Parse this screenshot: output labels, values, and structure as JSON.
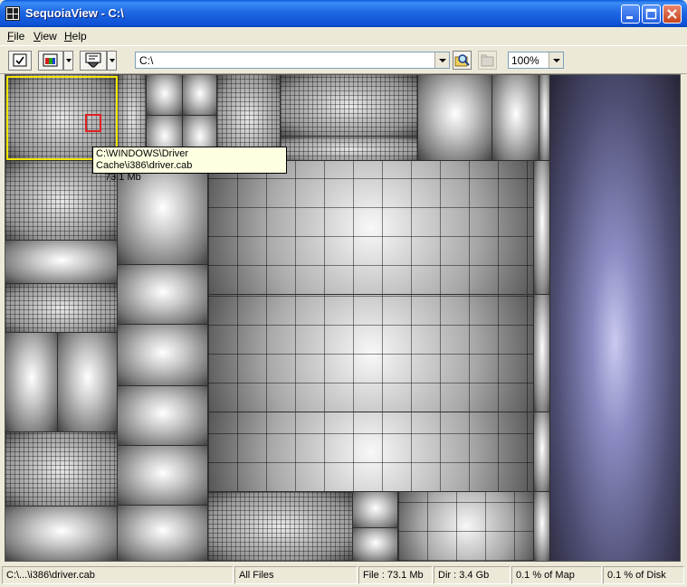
{
  "window": {
    "title": "SequoiaView - C:\\"
  },
  "menu": [
    {
      "key": "F",
      "rest": "ile"
    },
    {
      "key": "V",
      "rest": "iew"
    },
    {
      "key": "H",
      "rest": "elp"
    }
  ],
  "toolbar": {
    "path_value": "C:\\",
    "zoom_value": "100%"
  },
  "tooltip": {
    "path": "C:\\WINDOWS\\Driver Cache\\i386\\driver.cab",
    "size": "73.1 Mb"
  },
  "statusbar": {
    "path": "C:\\...\\i386\\driver.cab",
    "filter": "All Files",
    "file_size": "File : 73.1 Mb",
    "dir_size": "Dir : 3.4 Gb",
    "map_percent": "0.1 % of Map",
    "disk_percent": "0.1 % of Disk"
  },
  "colors": {
    "titlebar": "#0a5bd8",
    "selection_highlight": "#f2e600",
    "file_highlight": "#e02020",
    "tooltip_bg": "#ffffe1"
  }
}
